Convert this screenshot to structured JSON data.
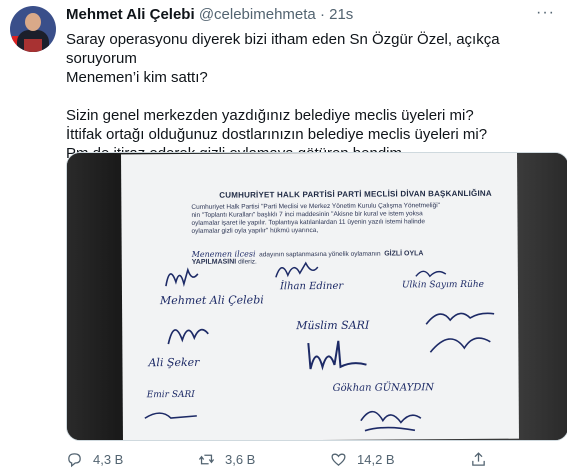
{
  "tweet": {
    "author_name": "Mehmet Ali Çelebi",
    "handle": "@celebimehmeta",
    "separator": "·",
    "time": "21s",
    "more_label": "···",
    "text_lines": [
      "Saray operasyonu diyerek bizi itham eden Sn Özgür Özel, açıkça soruyorum",
      "Menemen’i kim sattı?",
      "",
      "Sizin genel merkezden yazdığınız belediye meclis üyeleri mi?",
      "İttifak ortağı olduğunuz dostlarınızın belediye meclis üyeleri mi?",
      "Pm de itiraz ederek gizli oylamaya götüren bendim."
    ]
  },
  "document": {
    "title": "CUMHURİYET HALK PARTİSİ PARTİ MECLİSİ DİVAN BAŞKANLIĞINA",
    "body_lines": [
      "Cumhuriyet Halk Partisi \"Parti Meclisi ve Merkez Yönetim Kurulu Çalışma Yönetmeliği\"",
      "nin \"Toplantı Kuralları\" başlıklı 7 inci maddesinin \"Akisne bir kural ve istem yoksa",
      "oylamalar işaret ile yapılır. Toplantıya katılanlardan 11 üyenin yazılı istemi halinde",
      "oylamalar gizli oyla yapılır\" hükmü uyarınca,"
    ],
    "handwritten_place": "Menemen ilcesi",
    "line_middle": "adayının saptanmasına yönelik oylamanın",
    "bold_part": "GİZLİ OYLA",
    "bold_line2": "YAPILMASINI",
    "line_end": "dileriz.",
    "signatures": [
      "Mehmet Ali Çelebi",
      "İlhan Ediner",
      "Ulkin Sayım Rühe",
      "Müslim SARI",
      "Ali Şeker",
      "Emir SARI",
      "Gökhan GÜNAYDIN"
    ]
  },
  "actions": {
    "replies": "4,3 B",
    "retweets": "3,6 B",
    "likes": "14,2 B"
  }
}
